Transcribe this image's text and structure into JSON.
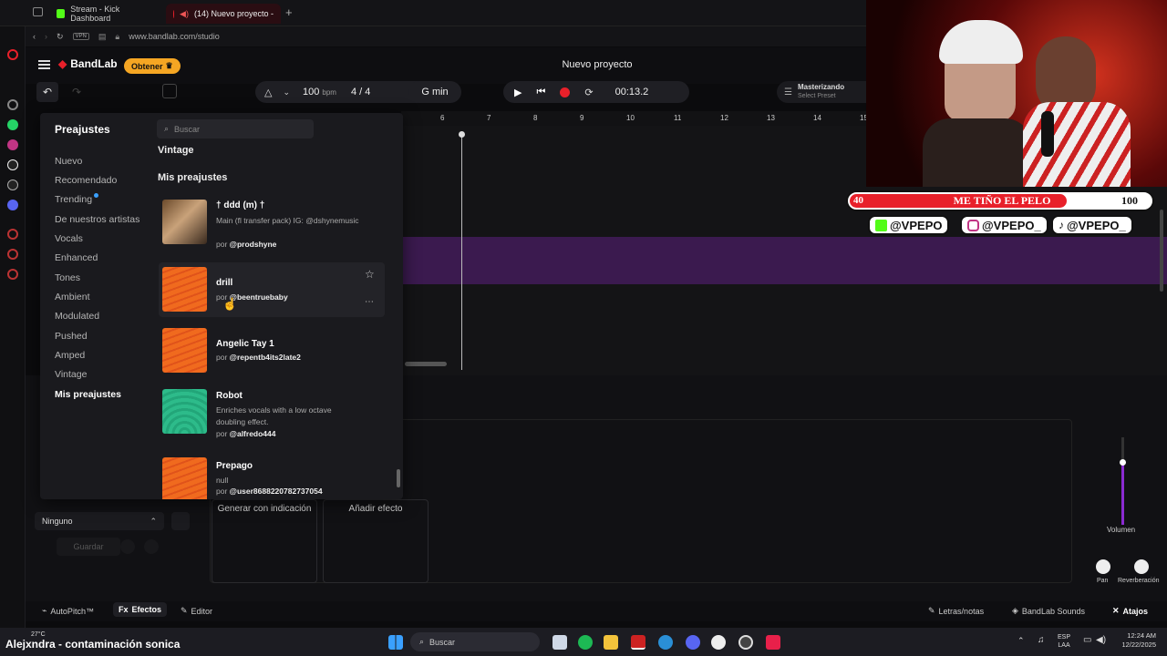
{
  "browser": {
    "tabs": [
      {
        "label": "Stream - Kick Dashboard",
        "active": false
      },
      {
        "label": "(14) Nuevo proyecto -",
        "active": true
      }
    ],
    "url": "www.bandlab.com/studio"
  },
  "bandlab": {
    "logo": "BandLab",
    "obtener": "Obtener",
    "project_title": "Nuevo proyecto",
    "tempo": "100",
    "tempo_unit": "bpm",
    "time_signature": "4 / 4",
    "key": "G min",
    "time": "00:13.2",
    "mastering_title": "Masterizando",
    "mastering_sub": "Select Preset",
    "ruler": [
      "6",
      "7",
      "8",
      "9",
      "10",
      "11",
      "12",
      "13",
      "14",
      "15"
    ]
  },
  "presets": {
    "title": "Preajustes",
    "search_placeholder": "Buscar",
    "categories": [
      "Nuevo",
      "Recomendado",
      "Trending",
      "De nuestros artistas",
      "Vocals",
      "Enhanced",
      "Tones",
      "Ambient",
      "Modulated",
      "Pushed",
      "Amped",
      "Vintage",
      "Mis preajustes"
    ],
    "selected_category": "Mis preajustes",
    "section_vintage": "Vintage",
    "section_mine": "Mis preajustes",
    "items": [
      {
        "name": "† ddd (m) †",
        "desc": "Main (fl transfer pack) IG: @dshynemusic",
        "by_prefix": "por",
        "by": "@prodshyne",
        "thumb": "photo"
      },
      {
        "name": "drill",
        "desc": "",
        "by_prefix": "por",
        "by": "@beentruebaby",
        "thumb": "orange"
      },
      {
        "name": "Angelic Tay 1",
        "desc": "",
        "by_prefix": "por",
        "by": "@repentb4its2late2",
        "thumb": "orange"
      },
      {
        "name": "Robot",
        "desc": "Enriches vocals with a low octave doubling effect.",
        "by_prefix": "por",
        "by": "@alfredo444",
        "thumb": "green"
      },
      {
        "name": "Prepago",
        "desc": "null",
        "by_prefix": "por",
        "by": "@user8688220782737054",
        "thumb": "orange"
      }
    ]
  },
  "effects": {
    "chain_select": "Ninguno",
    "save": "Guardar",
    "generate": "Generar con indicación",
    "add_effect": "Añadir efecto",
    "volume": "Volumen",
    "pan": "Pan",
    "reverb": "Reverberación"
  },
  "bottombar": {
    "autopitch": "AutoPitch™",
    "effects": "Efectos",
    "editor": "Editor",
    "lyrics": "Letras/notas",
    "sounds": "BandLab Sounds",
    "shortcuts": "Atajos"
  },
  "overlay": {
    "bar_left": "40",
    "bar_text": "ME TIÑO EL PELO",
    "bar_right": "100",
    "bar_fill_fraction": 0.72,
    "kick": "@VPEPO",
    "instagram": "@VPEPO_",
    "tiktok": "@VPEPO_"
  },
  "taskbar": {
    "weather": "27°C",
    "now_playing": "Alejxndra - contaminación sonica",
    "search": "Buscar",
    "lang1": "ESP",
    "lang2": "LAA",
    "clock_time": "12:24 AM",
    "clock_date": "12/22/2025"
  },
  "colors": {
    "accent_orange": "#f5a623",
    "record_red": "#e8202a",
    "purple_track": "#3b1a4f",
    "preset_orange": "#f06a1e",
    "preset_green": "#2dbb8a"
  }
}
